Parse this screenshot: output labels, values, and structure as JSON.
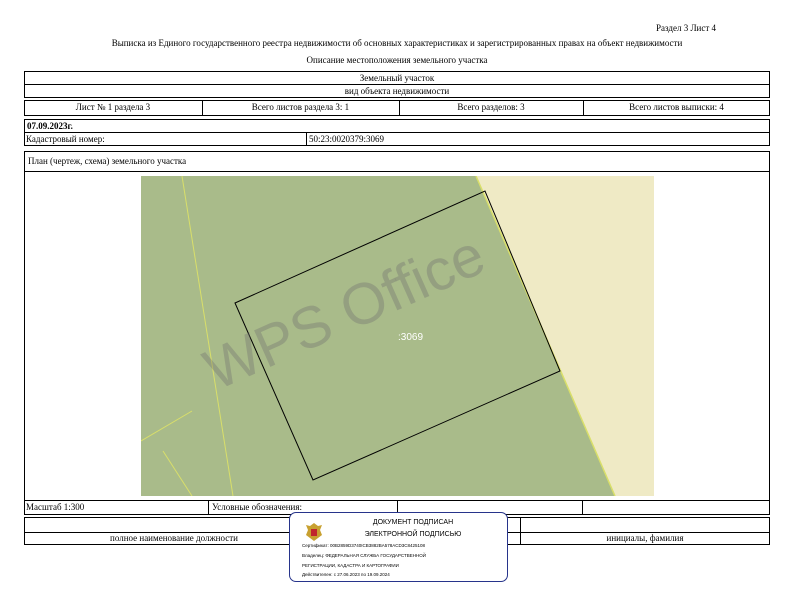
{
  "header": {
    "section_sheet": "Раздел 3    Лист 4",
    "title": "Выписка из Единого государственного реестра недвижимости об основных характеристиках и зарегистрированных правах на объект недвижимости",
    "subtitle": "Описание местоположения земельного участка"
  },
  "object": {
    "type": "Земельный участок",
    "kind": "вид объекта недвижимости"
  },
  "sheet_row": {
    "sheet_no": "Лист № 1 раздела 3",
    "total_sheets_section": "Всего листов раздела 3: 1",
    "total_sections": "Всего разделов: 3",
    "total_sheets_extract": "Всего листов выписки: 4"
  },
  "date": "07.09.2023г.",
  "cadastral": {
    "label": "Кадастровый номер:",
    "value": "50:23:0020379:3069"
  },
  "plan": {
    "label": "План (чертеж, схема) земельного участка",
    "parcel_label": ":3069",
    "watermark": "WPS Office",
    "colors": {
      "green": "#a9bb8a",
      "cream": "#efeac5",
      "boundary": "#d9df6a"
    }
  },
  "footer": {
    "scale": "Масштаб 1:300",
    "legend_label": "Условные обозначения:",
    "position_label": "полное наименование должности",
    "initials_label": "инициалы, фамилия"
  },
  "signature": {
    "line1": "ДОКУМЕНТ ПОДПИСАН",
    "line2": "ЭЛЕКТРОННОЙ ПОДПИСЬЮ",
    "cert": "Сертификат: 00B2859D3740ICB3882BA578ACD3C8425108",
    "owner1": "Владелец: ФЕДЕРАЛЬНАЯ СЛУЖБА ГОСУДАРСТВЕННОЙ",
    "owner2": "РЕГИСТРАЦИИ, КАДАСТРА И КАРТОГРАФИИ",
    "valid": "Действителен: с 27.06.2023 по 19.09.2024"
  }
}
